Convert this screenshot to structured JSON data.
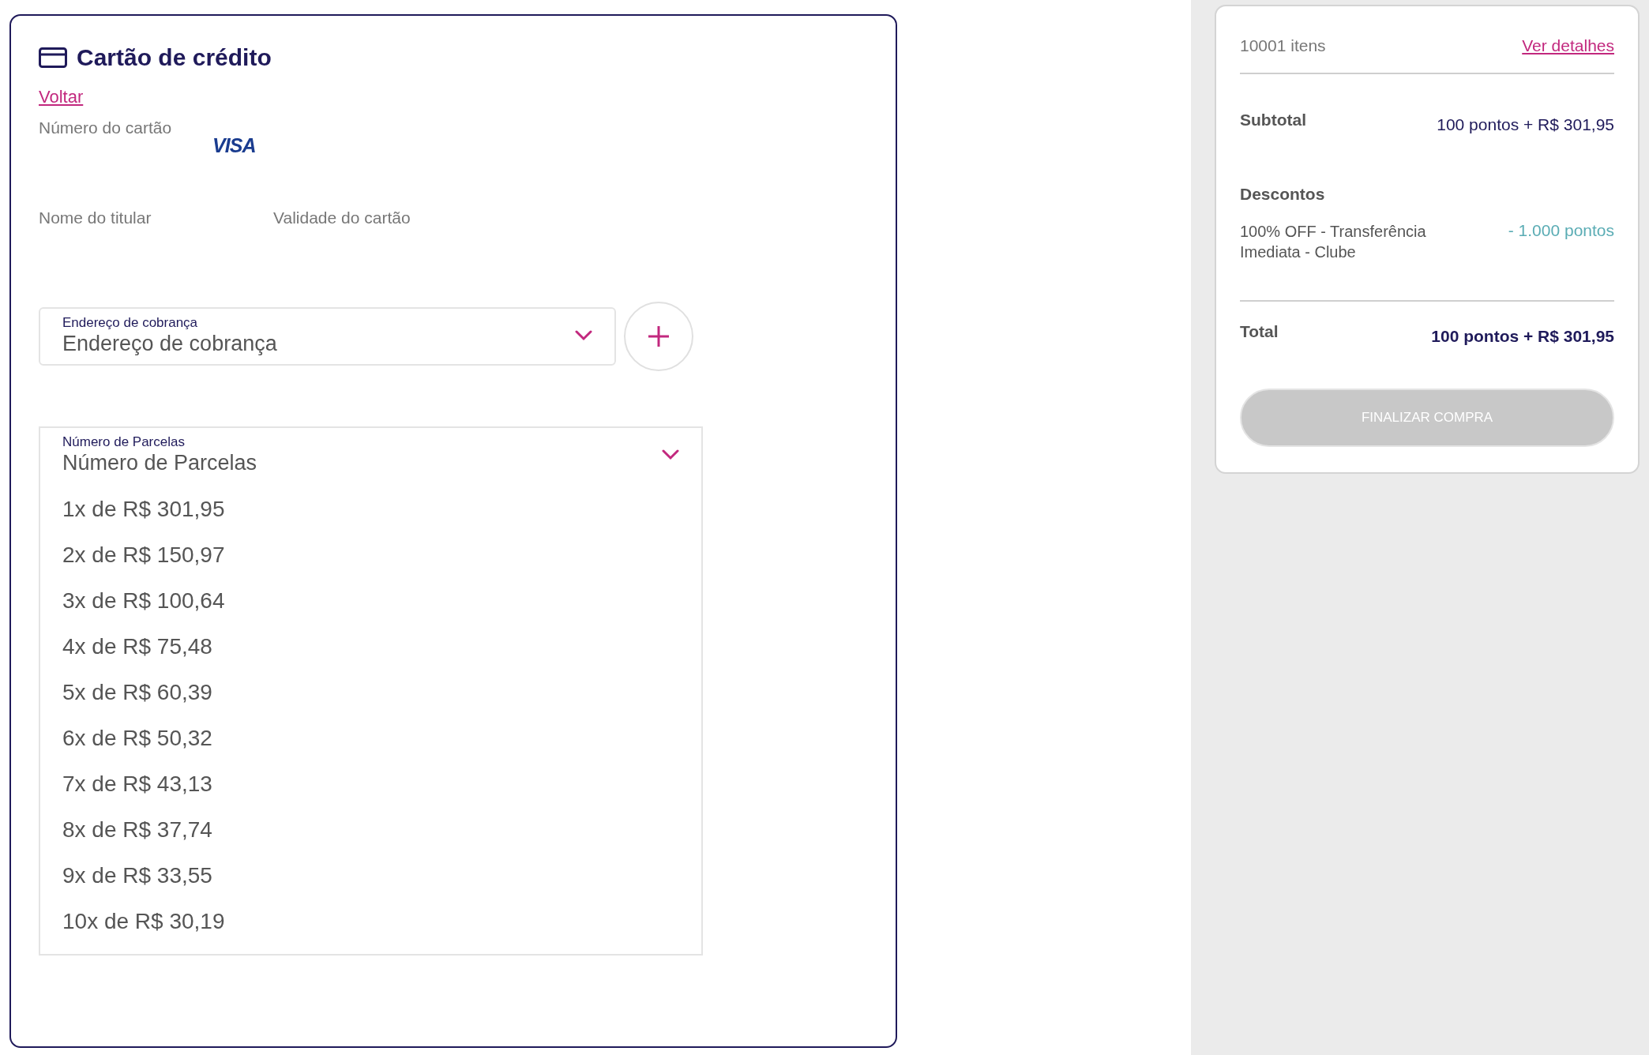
{
  "payment": {
    "title": "Cartão de crédito",
    "back_link": "Voltar",
    "card_number_label": "Número do cartão",
    "card_brand": "VISA",
    "holder_label": "Nome do titular",
    "expiry_label": "Validade do cartão",
    "billing_address": {
      "label": "Endereço de cobrança",
      "value": "Endereço de cobrança",
      "expanded": false
    },
    "installments": {
      "label": "Número de Parcelas",
      "value": "Número de Parcelas",
      "expanded": true,
      "options": [
        {
          "label": "1x de R$ 301,95",
          "selected": false
        },
        {
          "label": "2x de R$ 150,97",
          "selected": false
        },
        {
          "label": "3x de R$ 100,64",
          "selected": false
        },
        {
          "label": "4x de R$ 75,48",
          "selected": false
        },
        {
          "label": "5x de R$ 60,39",
          "selected": false
        },
        {
          "label": "6x de R$ 50,32",
          "selected": false
        },
        {
          "label": "7x de R$ 43,13",
          "selected": false
        },
        {
          "label": "8x de R$ 37,74",
          "selected": false
        },
        {
          "label": "9x de R$ 33,55",
          "selected": false
        },
        {
          "label": "10x de R$ 30,19",
          "selected": false
        }
      ]
    }
  },
  "summary": {
    "items_count": "10001 itens",
    "details_link": "Ver detalhes",
    "subtotal_label": "Subtotal",
    "subtotal_value": "100 pontos + R$ 301,95",
    "discounts_title": "Descontos",
    "discounts": [
      {
        "name": "100% OFF - Transferência Imediata - Clube",
        "value": "- 1.000 pontos"
      }
    ],
    "total_label": "Total",
    "total_value": "100 pontos + R$ 301,95",
    "checkout_button": {
      "label": "FINALIZAR COMPRA",
      "disabled": true
    }
  }
}
